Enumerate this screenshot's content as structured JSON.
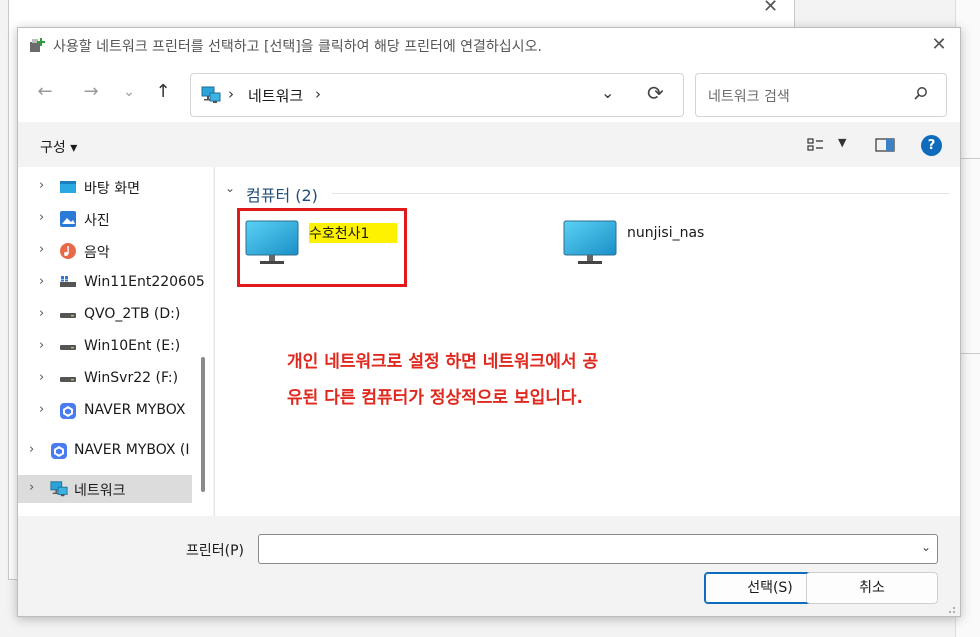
{
  "dialog": {
    "title": "사용할 네트워크 프린터를 선택하고 [선택]을 클릭하여 해당 프린터에 연결하십시오.",
    "close_glyph": "✕"
  },
  "background": {
    "close_glyph": "✕"
  },
  "nav": {
    "back_glyph": "←",
    "forward_glyph": "→",
    "recent_glyph": "⌄",
    "up_glyph": "↑",
    "address_sep": "›",
    "address_location": "네트워크",
    "address_dropdown_glyph": "⌄",
    "refresh_glyph": "⟳"
  },
  "search": {
    "placeholder": "네트워크 검색"
  },
  "toolbar": {
    "organize_label": "구성 ▾",
    "view_dropdown_glyph": "▼",
    "help_label": "?"
  },
  "sidebar": {
    "chevron": "›",
    "items": [
      {
        "label": "바탕 화면",
        "icon": "desktop-icon"
      },
      {
        "label": "사진",
        "icon": "pictures-icon"
      },
      {
        "label": "음악",
        "icon": "music-icon"
      },
      {
        "label": "Win11Ent220605",
        "icon": "network-drive-icon"
      },
      {
        "label": "QVO_2TB (D:)",
        "icon": "drive-icon"
      },
      {
        "label": "Win10Ent (E:)",
        "icon": "drive-icon"
      },
      {
        "label": "WinSvr22 (F:)",
        "icon": "drive-icon"
      },
      {
        "label": "NAVER MYBOX",
        "icon": "mybox-icon"
      },
      {
        "label": "NAVER MYBOX (I",
        "icon": "mybox-icon"
      },
      {
        "label": "네트워크",
        "icon": "network-icon",
        "selected": true
      }
    ]
  },
  "content": {
    "group_chevron": "⌄",
    "group_title": "컴퓨터 (2)",
    "computers": [
      {
        "name": "수호천사1",
        "highlighted": true,
        "icon": "computer-icon"
      },
      {
        "name": "nunjisi_nas",
        "icon": "computer-icon"
      }
    ],
    "note_lines": [
      "개인 네트워크로 설정 하면 네트워크에서 공",
      "유된 다른 컴퓨터가 정상적으로 보입니다."
    ],
    "colors": {
      "note": "#e0281e",
      "highlight": "#fff200",
      "box": "#e01a1a"
    }
  },
  "bottom": {
    "printer_label": "프린터(P)",
    "printer_value": "",
    "printer_drop_glyph": "⌄",
    "select_label": "선택(S)",
    "cancel_label": "취소"
  }
}
